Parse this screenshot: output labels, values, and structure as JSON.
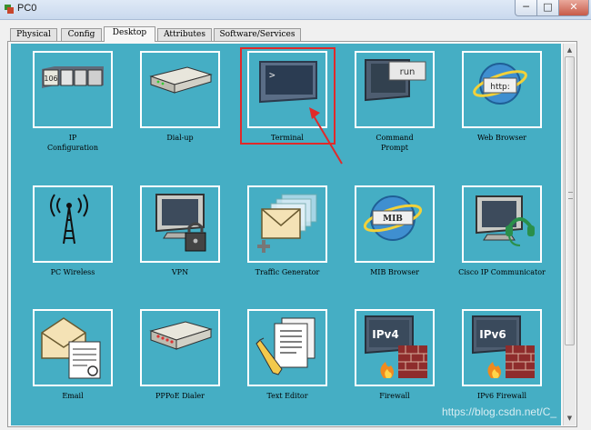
{
  "window": {
    "title": "PC0",
    "minimize_glyph": "─",
    "maximize_glyph": "□",
    "close_glyph": "✕"
  },
  "tabs": [
    {
      "label": "Physical"
    },
    {
      "label": "Config"
    },
    {
      "label": "Desktop",
      "active": true
    },
    {
      "label": "Attributes"
    },
    {
      "label": "Software/Services"
    }
  ],
  "apps": [
    {
      "label": "IP\nConfiguration",
      "icon": "ip-configuration-icon",
      "glyph": "106"
    },
    {
      "label": "Dial-up",
      "icon": "modem-icon"
    },
    {
      "label": "Terminal",
      "icon": "terminal-icon",
      "glyph": ">"
    },
    {
      "label": "Command\nPrompt",
      "icon": "command-prompt-icon",
      "glyph": "run"
    },
    {
      "label": "Web Browser",
      "icon": "globe-icon",
      "glyph": "http:"
    },
    {
      "label": "PC Wireless",
      "icon": "wireless-tower-icon"
    },
    {
      "label": "VPN",
      "icon": "vpn-lock-icon"
    },
    {
      "label": "Traffic Generator",
      "icon": "envelope-stack-icon"
    },
    {
      "label": "MIB Browser",
      "icon": "mib-globe-icon",
      "glyph": "MIB"
    },
    {
      "label": "Cisco IP Communicator",
      "icon": "headset-monitor-icon"
    },
    {
      "label": "Email",
      "icon": "email-icon"
    },
    {
      "label": "PPPoE Dialer",
      "icon": "dialer-icon"
    },
    {
      "label": "Text Editor",
      "icon": "text-editor-icon"
    },
    {
      "label": "Firewall",
      "icon": "firewall-icon",
      "glyph": "IPv4"
    },
    {
      "label": "IPv6 Firewall",
      "icon": "ipv6-firewall-icon",
      "glyph": "IPv6"
    }
  ],
  "annotation": {
    "highlighted_app": "Terminal",
    "color": "#e02a2a"
  },
  "watermark": "https://blog.csdn.net/C_",
  "colors": {
    "desktop_bg": "#45aec4",
    "tile_border": "#ffffff"
  }
}
